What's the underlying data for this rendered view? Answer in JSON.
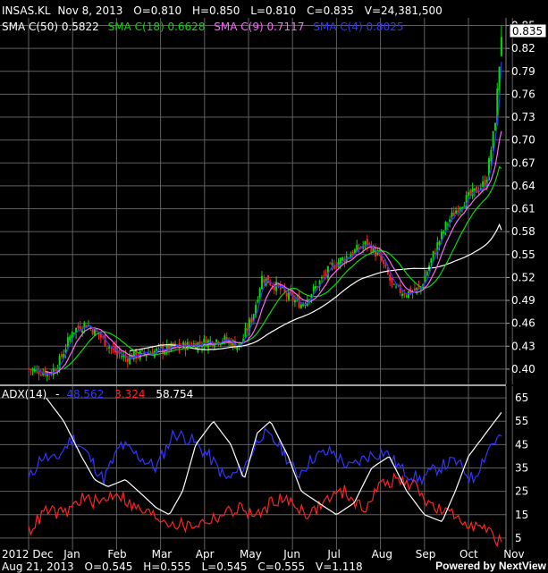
{
  "header": {
    "symbol": "INSAS.KL",
    "date": "Nov 8, 2013",
    "open": "O=0.810",
    "high": "H=0.850",
    "low": "L=0.810",
    "close": "C=0.835",
    "volume": "V=24,381,500"
  },
  "sma_legend": [
    {
      "label": "SMA C(50) 0.5822",
      "color": "#ffffff"
    },
    {
      "label": "SMA C(18) 0.6628",
      "color": "#00dd00"
    },
    {
      "label": "SMA C(9) 0.7117",
      "color": "#ff66ff"
    },
    {
      "label": "SMA C(4) 0.8025",
      "color": "#3333ff"
    }
  ],
  "adx_legend": {
    "title": "ADX(14)",
    "dash": "-",
    "adx": {
      "value": "48.562",
      "color": "#3333ff"
    },
    "minus_di": {
      "value": "3.324",
      "color": "#ff2222"
    },
    "plus_di": {
      "value": "58.754",
      "color": "#ffffff"
    }
  },
  "footer": {
    "date": "Aug 21, 2013",
    "open": "O=0.545",
    "high": "H=0.555",
    "low": "L=0.545",
    "close": "C=0.555",
    "volume": "V=1.118"
  },
  "brand": {
    "powered": "Powered by",
    "name": "NextView"
  },
  "chart_data": [
    {
      "type": "candlestick",
      "ylim": [
        0.38,
        0.86
      ],
      "y_ticks": [
        "0.85",
        "0.82",
        "0.79",
        "0.76",
        "0.73",
        "0.70",
        "0.67",
        "0.64",
        "0.61",
        "0.58",
        "0.55",
        "0.52",
        "0.49",
        "0.46",
        "0.43",
        "0.40"
      ],
      "last_price_label": "0.835",
      "x_tick_labels": [
        "2012 Dec",
        "Jan",
        "Feb",
        "Mar",
        "Apr",
        "May",
        "Jun",
        "Jul",
        "Aug",
        "Sep",
        "Oct",
        "Nov"
      ],
      "colors": {
        "up": "#00dd00",
        "down": "#ff2222",
        "grid": "#606060"
      },
      "series": [
        {
          "name": "SMA C(4)",
          "color": "#3333ff",
          "last": 0.8025
        },
        {
          "name": "SMA C(9)",
          "color": "#ff66ff",
          "last": 0.7117
        },
        {
          "name": "SMA C(18)",
          "color": "#00dd00",
          "last": 0.6628
        },
        {
          "name": "SMA C(50)",
          "color": "#ffffff",
          "last": 0.5822
        }
      ],
      "close_anchors": [
        {
          "month": 0,
          "close": 0.4
        },
        {
          "month": 0.5,
          "close": 0.395
        },
        {
          "month": 0.7,
          "close": 0.41
        },
        {
          "month": 1.0,
          "close": 0.45
        },
        {
          "month": 1.3,
          "close": 0.46
        },
        {
          "month": 1.6,
          "close": 0.445
        },
        {
          "month": 1.9,
          "close": 0.425
        },
        {
          "month": 2.2,
          "close": 0.415
        },
        {
          "month": 2.6,
          "close": 0.42
        },
        {
          "month": 3.0,
          "close": 0.425
        },
        {
          "month": 3.5,
          "close": 0.43
        },
        {
          "month": 4.0,
          "close": 0.435
        },
        {
          "month": 4.4,
          "close": 0.44
        },
        {
          "month": 4.8,
          "close": 0.43
        },
        {
          "month": 5.1,
          "close": 0.47
        },
        {
          "month": 5.3,
          "close": 0.52
        },
        {
          "month": 5.6,
          "close": 0.51
        },
        {
          "month": 5.9,
          "close": 0.495
        },
        {
          "month": 6.2,
          "close": 0.485
        },
        {
          "month": 6.5,
          "close": 0.505
        },
        {
          "month": 6.9,
          "close": 0.535
        },
        {
          "month": 7.3,
          "close": 0.55
        },
        {
          "month": 7.7,
          "close": 0.565
        },
        {
          "month": 8.0,
          "close": 0.545
        },
        {
          "month": 8.3,
          "close": 0.505
        },
        {
          "month": 8.6,
          "close": 0.5
        },
        {
          "month": 8.9,
          "close": 0.505
        },
        {
          "month": 9.2,
          "close": 0.55
        },
        {
          "month": 9.5,
          "close": 0.59
        },
        {
          "month": 9.8,
          "close": 0.615
        },
        {
          "month": 10.1,
          "close": 0.63
        },
        {
          "month": 10.4,
          "close": 0.645
        },
        {
          "month": 10.6,
          "close": 0.72
        },
        {
          "month": 10.75,
          "close": 0.835
        }
      ]
    },
    {
      "type": "line",
      "title": "ADX(14)",
      "ylim": [
        0,
        70
      ],
      "y_ticks": [
        "65",
        "55",
        "45",
        "35",
        "25",
        "15",
        "5"
      ],
      "series": [
        {
          "name": "ADX",
          "color": "#3333ff",
          "last": 48.562,
          "points": [
            [
              0,
              30
            ],
            [
              0.3,
              40
            ],
            [
              0.6,
              38
            ],
            [
              1.0,
              48
            ],
            [
              1.3,
              42
            ],
            [
              1.7,
              30
            ],
            [
              2.1,
              45
            ],
            [
              2.5,
              40
            ],
            [
              2.9,
              35
            ],
            [
              3.3,
              50
            ],
            [
              3.7,
              47
            ],
            [
              4.1,
              40
            ],
            [
              4.5,
              30
            ],
            [
              4.9,
              35
            ],
            [
              5.3,
              50
            ],
            [
              5.7,
              45
            ],
            [
              6.1,
              32
            ],
            [
              6.5,
              40
            ],
            [
              6.9,
              42
            ],
            [
              7.3,
              35
            ],
            [
              7.7,
              40
            ],
            [
              8.1,
              42
            ],
            [
              8.5,
              34
            ],
            [
              8.9,
              30
            ],
            [
              9.3,
              35
            ],
            [
              9.7,
              38
            ],
            [
              10.1,
              30
            ],
            [
              10.5,
              45
            ],
            [
              10.75,
              48.562
            ]
          ]
        },
        {
          "name": "-DI",
          "color": "#ff2222",
          "last": 3.324,
          "points": [
            [
              0,
              8
            ],
            [
              0.4,
              17
            ],
            [
              0.8,
              15
            ],
            [
              1.2,
              22
            ],
            [
              1.6,
              20
            ],
            [
              2.0,
              25
            ],
            [
              2.4,
              18
            ],
            [
              2.8,
              15
            ],
            [
              3.2,
              12
            ],
            [
              3.6,
              10
            ],
            [
              4.0,
              12
            ],
            [
              4.4,
              15
            ],
            [
              4.8,
              18
            ],
            [
              5.2,
              14
            ],
            [
              5.6,
              22
            ],
            [
              6.0,
              20
            ],
            [
              6.4,
              15
            ],
            [
              6.8,
              22
            ],
            [
              7.2,
              25
            ],
            [
              7.6,
              17
            ],
            [
              8.0,
              28
            ],
            [
              8.4,
              30
            ],
            [
              8.8,
              27
            ],
            [
              9.2,
              18
            ],
            [
              9.6,
              15
            ],
            [
              10.0,
              12
            ],
            [
              10.4,
              8
            ],
            [
              10.75,
              3.324
            ]
          ]
        },
        {
          "name": "+DI",
          "color": "#ffffff",
          "last": 58.754,
          "points": [
            [
              0.4,
              65
            ],
            [
              0.8,
              55
            ],
            [
              1.2,
              40
            ],
            [
              1.5,
              30
            ],
            [
              1.8,
              27
            ],
            [
              2.2,
              30
            ],
            [
              2.5,
              25
            ],
            [
              2.9,
              18
            ],
            [
              3.2,
              15
            ],
            [
              3.5,
              25
            ],
            [
              3.8,
              45
            ],
            [
              4.2,
              55
            ],
            [
              4.6,
              45
            ],
            [
              4.9,
              30
            ],
            [
              5.2,
              50
            ],
            [
              5.5,
              55
            ],
            [
              5.9,
              40
            ],
            [
              6.2,
              25
            ],
            [
              6.6,
              20
            ],
            [
              7.0,
              15
            ],
            [
              7.4,
              20
            ],
            [
              7.8,
              35
            ],
            [
              8.2,
              40
            ],
            [
              8.6,
              25
            ],
            [
              9.0,
              15
            ],
            [
              9.4,
              12
            ],
            [
              9.7,
              25
            ],
            [
              10.0,
              40
            ],
            [
              10.4,
              50
            ],
            [
              10.75,
              58.754
            ]
          ]
        }
      ]
    }
  ]
}
